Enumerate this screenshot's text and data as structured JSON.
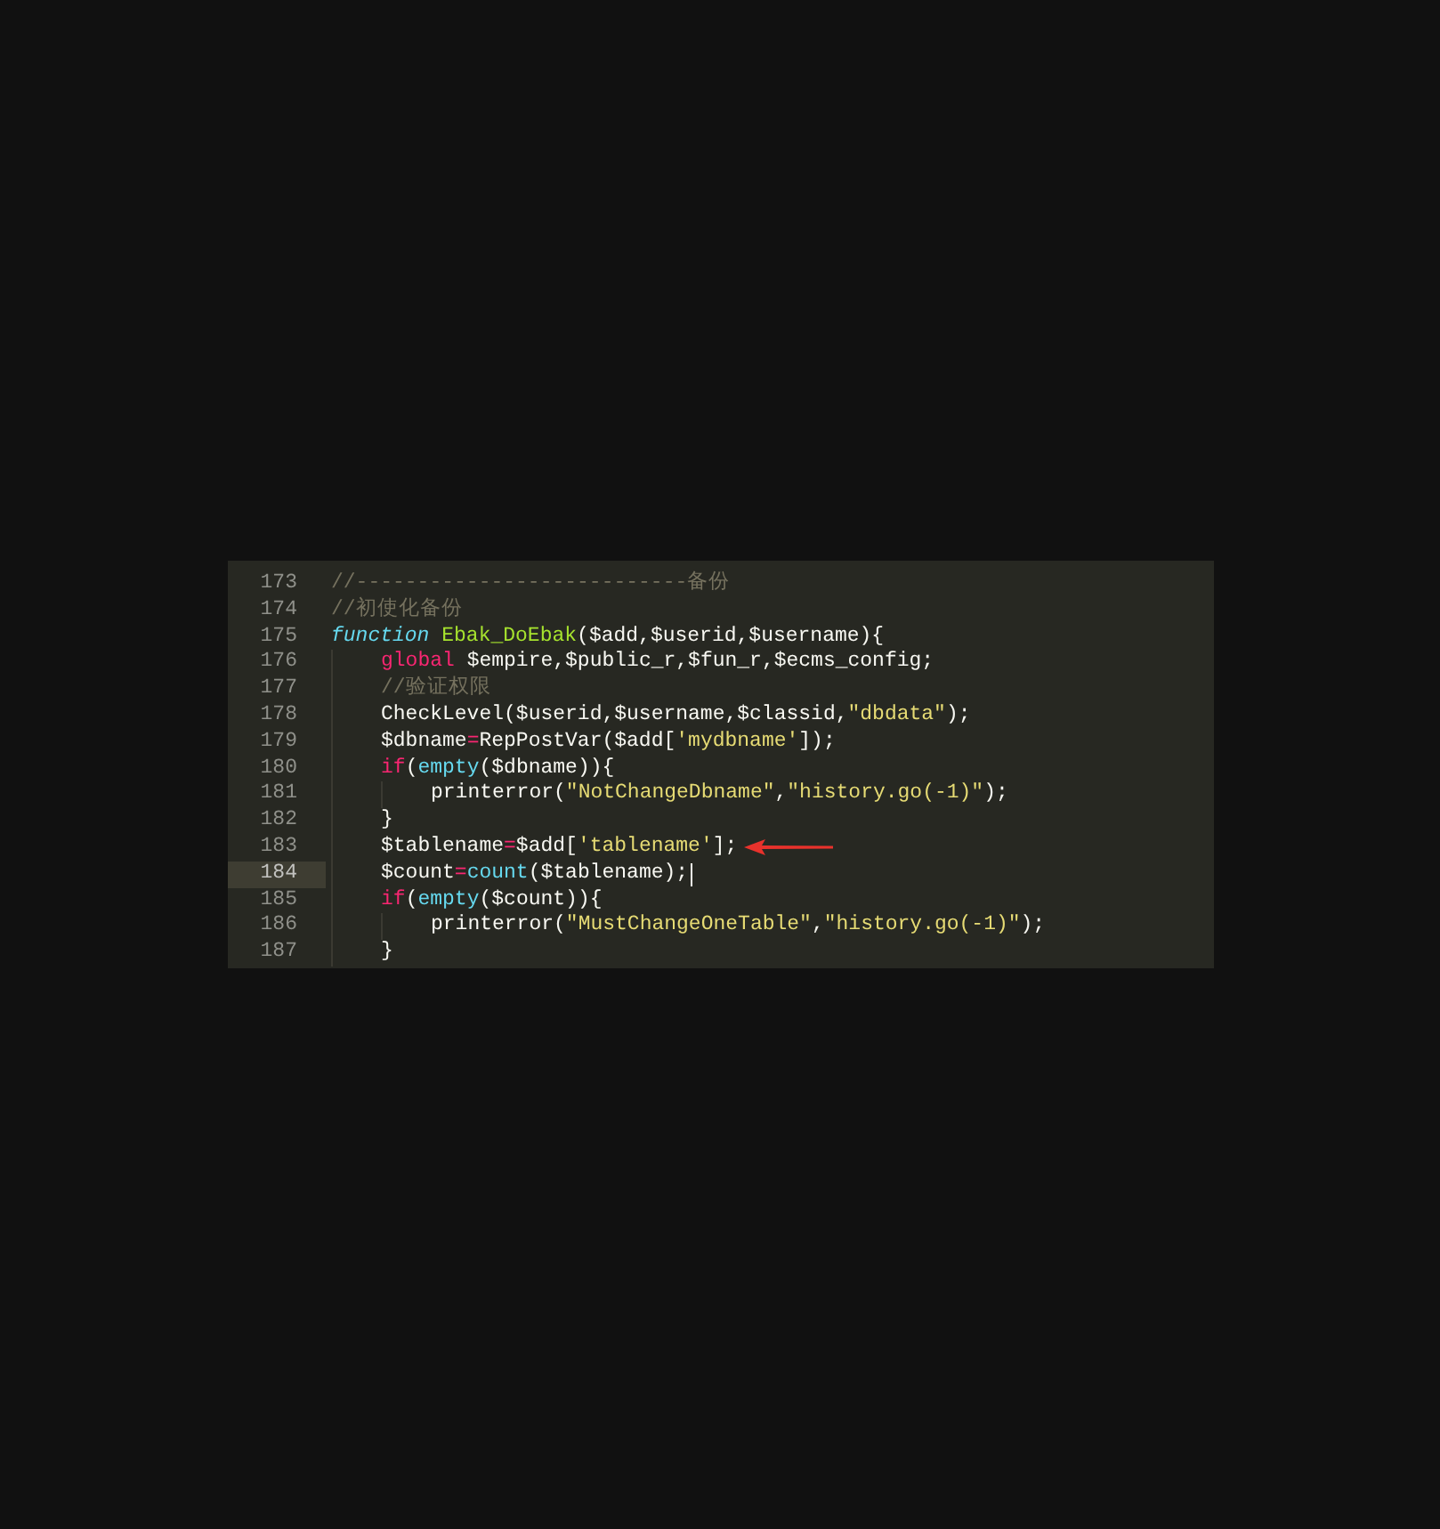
{
  "editor": {
    "lines": [
      {
        "number": "173",
        "current": false,
        "cursor": false,
        "annotated": false,
        "tokens": [
          {
            "text": "//---------------------------备份",
            "kind": "comment"
          }
        ]
      },
      {
        "number": "174",
        "current": false,
        "cursor": false,
        "annotated": false,
        "tokens": [
          {
            "text": "//初使化备份",
            "kind": "comment"
          }
        ]
      },
      {
        "number": "175",
        "current": false,
        "cursor": false,
        "annotated": false,
        "tokens": [
          {
            "text": "function ",
            "kind": "storage"
          },
          {
            "text": "Ebak_DoEbak",
            "kind": "fn"
          },
          {
            "text": "($add,$userid,$username){",
            "kind": "plain"
          }
        ],
        "children": [
          {
            "number": "176",
            "current": false,
            "cursor": false,
            "annotated": false,
            "tokens": [
              {
                "text": "global",
                "kind": "keyword"
              },
              {
                "text": " $empire,$public_r,$fun_r,$ecms_config;",
                "kind": "plain"
              }
            ]
          },
          {
            "number": "177",
            "current": false,
            "cursor": false,
            "annotated": false,
            "tokens": [
              {
                "text": "//验证权限",
                "kind": "comment"
              }
            ]
          },
          {
            "number": "178",
            "current": false,
            "cursor": false,
            "annotated": false,
            "tokens": [
              {
                "text": "CheckLevel($userid,$username,$classid,",
                "kind": "plain"
              },
              {
                "text": "\"dbdata\"",
                "kind": "string"
              },
              {
                "text": ");",
                "kind": "plain"
              }
            ]
          },
          {
            "number": "179",
            "current": false,
            "cursor": false,
            "annotated": false,
            "tokens": [
              {
                "text": "$dbname",
                "kind": "plain"
              },
              {
                "text": "=",
                "kind": "keyword"
              },
              {
                "text": "RepPostVar($add[",
                "kind": "plain"
              },
              {
                "text": "'mydbname'",
                "kind": "string"
              },
              {
                "text": "]);",
                "kind": "plain"
              }
            ]
          },
          {
            "number": "180",
            "current": false,
            "cursor": false,
            "annotated": false,
            "tokens": [
              {
                "text": "if",
                "kind": "keyword"
              },
              {
                "text": "(",
                "kind": "plain"
              },
              {
                "text": "empty",
                "kind": "builtin"
              },
              {
                "text": "($dbname)){",
                "kind": "plain"
              }
            ],
            "children": [
              {
                "number": "181",
                "current": false,
                "cursor": false,
                "annotated": false,
                "tokens": [
                  {
                    "text": "printerror(",
                    "kind": "plain"
                  },
                  {
                    "text": "\"NotChangeDbname\"",
                    "kind": "string"
                  },
                  {
                    "text": ",",
                    "kind": "plain"
                  },
                  {
                    "text": "\"history.go(-1)\"",
                    "kind": "string"
                  },
                  {
                    "text": ");",
                    "kind": "plain"
                  }
                ]
              }
            ]
          },
          {
            "number": "182",
            "current": false,
            "cursor": false,
            "annotated": false,
            "tokens": [
              {
                "text": "}",
                "kind": "plain"
              }
            ]
          },
          {
            "number": "183",
            "current": false,
            "cursor": false,
            "annotated": true,
            "tokens": [
              {
                "text": "$tablename",
                "kind": "plain"
              },
              {
                "text": "=",
                "kind": "keyword"
              },
              {
                "text": "$add[",
                "kind": "plain"
              },
              {
                "text": "'tablename'",
                "kind": "string"
              },
              {
                "text": "];",
                "kind": "plain"
              }
            ]
          },
          {
            "number": "184",
            "current": true,
            "cursor": true,
            "annotated": false,
            "tokens": [
              {
                "text": "$count",
                "kind": "plain"
              },
              {
                "text": "=",
                "kind": "keyword"
              },
              {
                "text": "count",
                "kind": "builtin"
              },
              {
                "text": "($tablename);",
                "kind": "plain"
              }
            ]
          },
          {
            "number": "185",
            "current": false,
            "cursor": false,
            "annotated": false,
            "tokens": [
              {
                "text": "if",
                "kind": "keyword"
              },
              {
                "text": "(",
                "kind": "plain"
              },
              {
                "text": "empty",
                "kind": "builtin"
              },
              {
                "text": "($count)){",
                "kind": "plain"
              }
            ],
            "children": [
              {
                "number": "186",
                "current": false,
                "cursor": false,
                "annotated": false,
                "tokens": [
                  {
                    "text": "printerror(",
                    "kind": "plain"
                  },
                  {
                    "text": "\"MustChangeOneTable\"",
                    "kind": "string"
                  },
                  {
                    "text": ",",
                    "kind": "plain"
                  },
                  {
                    "text": "\"history.go(-1)\"",
                    "kind": "string"
                  },
                  {
                    "text": ");",
                    "kind": "plain"
                  }
                ]
              }
            ]
          },
          {
            "number": "187",
            "current": false,
            "cursor": false,
            "annotated": false,
            "tokens": [
              {
                "text": "}",
                "kind": "plain"
              }
            ]
          }
        ]
      }
    ]
  }
}
